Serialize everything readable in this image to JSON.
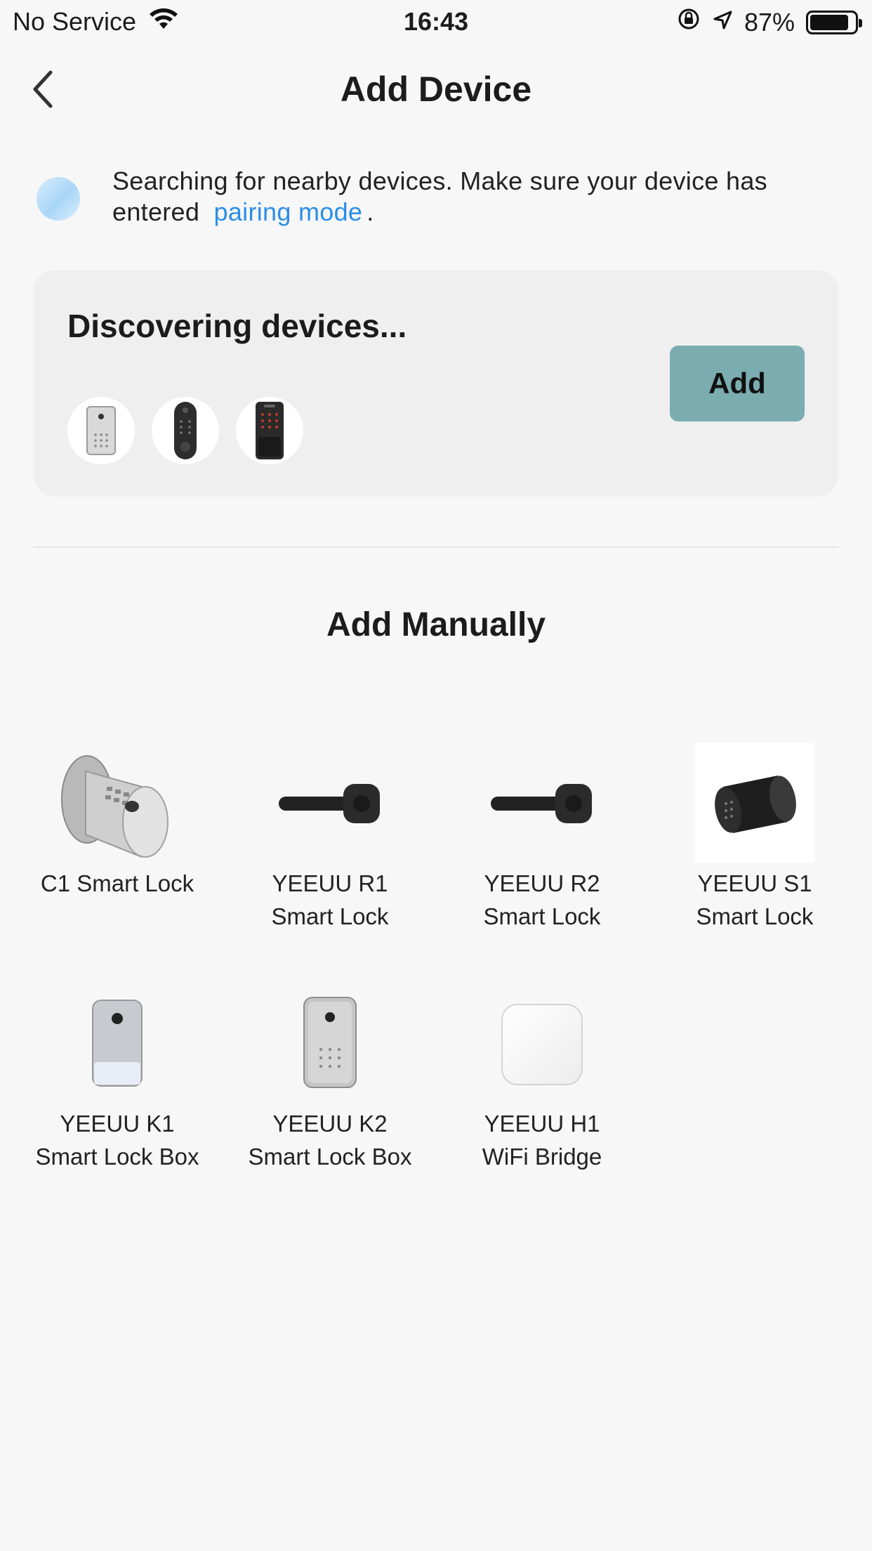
{
  "status_bar": {
    "carrier": "No Service",
    "time": "16:43",
    "battery": "87%",
    "battery_level": 0.87
  },
  "nav": {
    "title": "Add Device"
  },
  "search_hint": {
    "text": "Searching for nearby devices. Make sure your device has entered",
    "link": "pairing mode",
    "suffix": "."
  },
  "discover": {
    "title": "Discovering devices...",
    "add_label": "Add",
    "accent": "#7aacb0"
  },
  "manual": {
    "title": "Add Manually",
    "devices": [
      {
        "name": "C1 Smart Lock",
        "icon": "c1-lock-icon"
      },
      {
        "name": "YEEUU R1 Smart Lock",
        "icon": "lever-lock-icon"
      },
      {
        "name": "YEEUU R2 Smart Lock",
        "icon": "lever-lock-icon"
      },
      {
        "name": "YEEUU S1 Smart Lock",
        "icon": "cylinder-lock-icon"
      },
      {
        "name": "YEEUU K1 Smart Lock Box",
        "icon": "lock-box-icon"
      },
      {
        "name": "YEEUU K2 Smart Lock Box",
        "icon": "keypad-lock-box-icon"
      },
      {
        "name": "YEEUU H1 WiFi Bridge",
        "icon": "wifi-bridge-icon"
      }
    ]
  },
  "colors": {
    "link": "#2a8ee8",
    "background": "#f7f7f7",
    "card": "#efefef"
  }
}
